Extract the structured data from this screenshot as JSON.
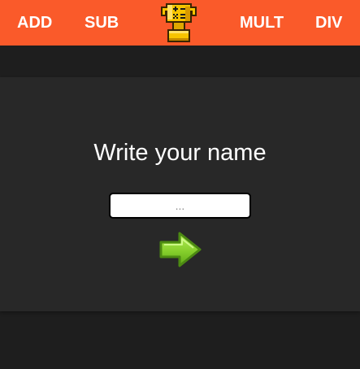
{
  "nav": {
    "add_label": "ADD",
    "sub_label": "SUB",
    "mult_label": "MULT",
    "div_label": "DIV",
    "logo_icon": "trophy-icon"
  },
  "colors": {
    "topbar": "#fa5a2a",
    "background": "#1e1e1e",
    "card": "#282828",
    "arrow": "#7cc12e"
  },
  "form": {
    "heading": "Write your name",
    "name_value": "",
    "name_placeholder": "...",
    "submit_icon": "arrow-right-icon"
  }
}
